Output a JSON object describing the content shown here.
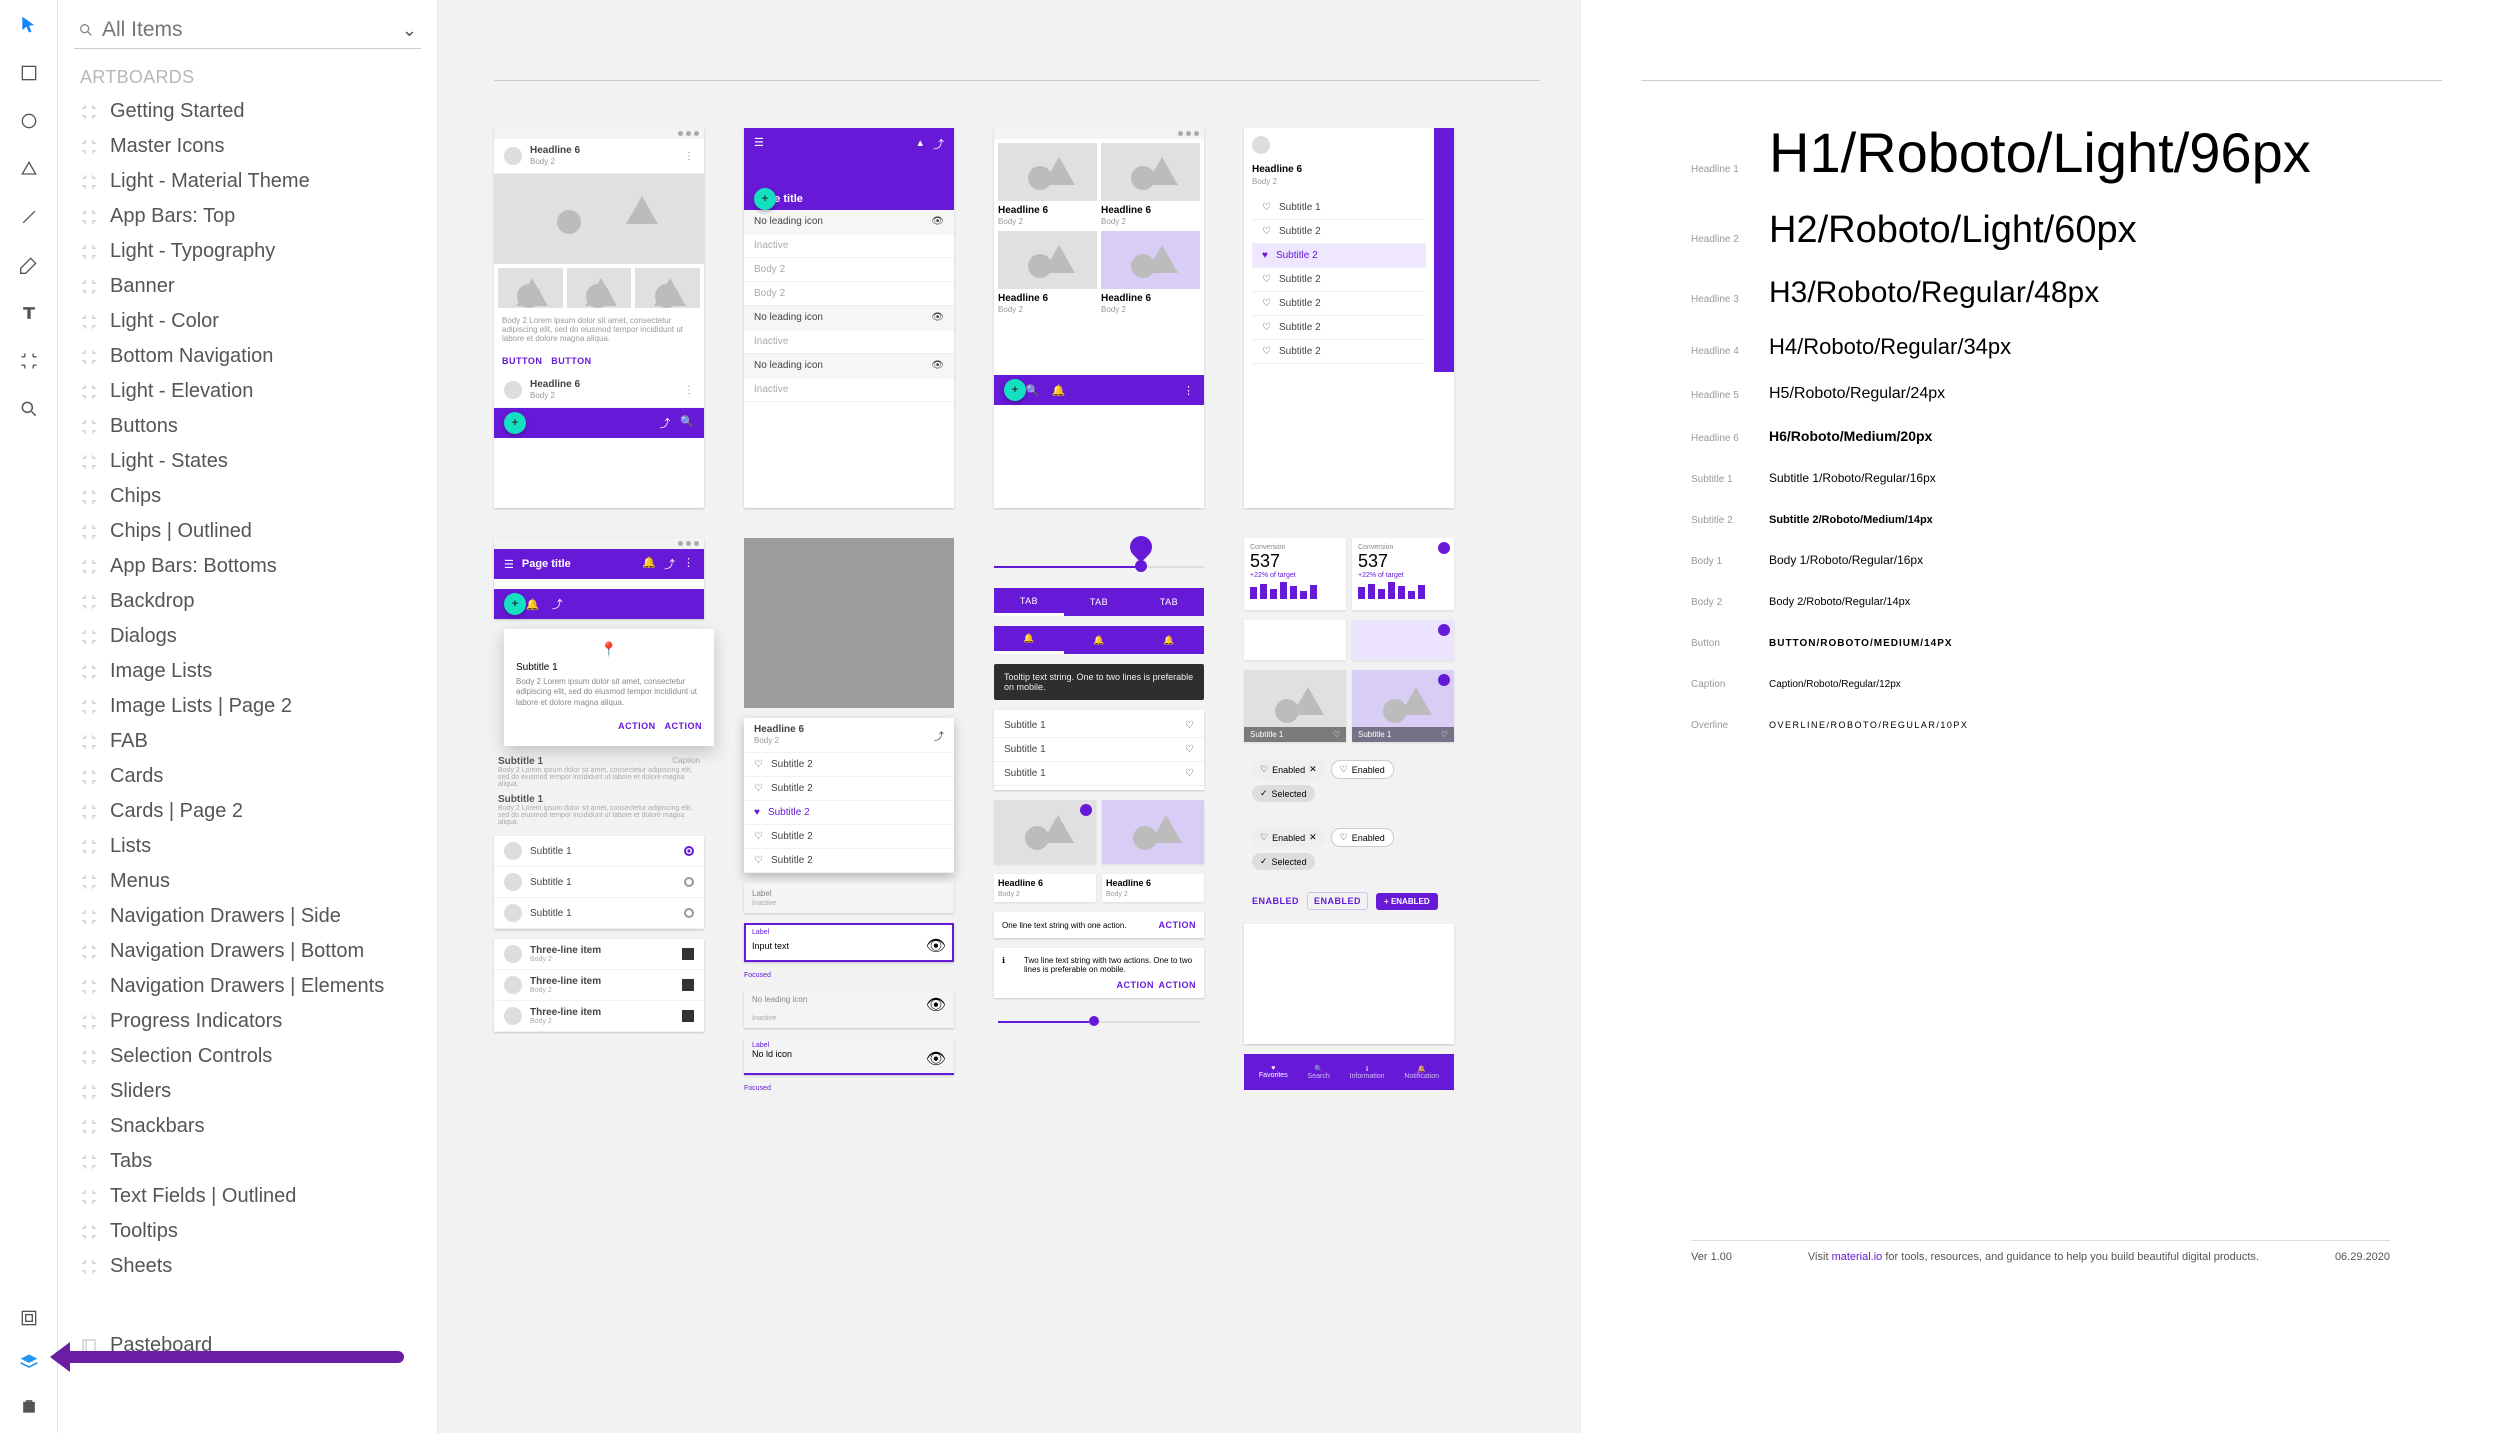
{
  "search": {
    "placeholder": "All Items"
  },
  "sections": {
    "artboards": "ARTBOARDS"
  },
  "artboards": [
    "Getting Started",
    "Master Icons",
    "Light - Material Theme",
    "App Bars: Top",
    "Light - Typography",
    "Banner",
    "Light - Color",
    "Bottom Navigation",
    "Light - Elevation",
    "Buttons",
    "Light - States",
    "Chips",
    "Chips | Outlined",
    "App Bars: Bottoms",
    "Backdrop",
    "Dialogs",
    "Image Lists",
    "Image Lists | Page 2",
    "FAB",
    "Cards",
    "Cards | Page 2",
    "Lists",
    "Menus",
    "Navigation Drawers | Side",
    "Navigation Drawers | Bottom",
    "Navigation Drawers | Elements",
    "Progress Indicators",
    "Selection Controls",
    "Sliders",
    "Snackbars",
    "Tabs",
    "Text Fields | Outlined",
    "Tooltips",
    "Sheets"
  ],
  "pasteboard": "Pasteboard",
  "canvas": {
    "headline6": "Headline 6",
    "body2": "Body 2",
    "pageTitle": "Page title",
    "noLeading": "No leading icon",
    "inactive": "Inactive",
    "subtitle1": "Subtitle 1",
    "subtitle2": "Subtitle 2",
    "threeLine": "Three-line item",
    "inputText": "Input text",
    "label": "Label",
    "focused": "Focused",
    "noIdIcon": "No ld icon",
    "action": "ACTION",
    "button": "BUTTON",
    "tab": "TAB",
    "snackOne": "One line text string with one action.",
    "snackTwo": "Two line text string with two actions. One to two lines is preferable on mobile.",
    "tooltip": "Tooltip text string. One to two lines is preferable on mobile.",
    "enabled": "Enabled",
    "enabledUpper": "ENABLED",
    "selected": "Selected",
    "caption": "Caption",
    "lorem": "Body 2 Lorem ipsum dolor sit amet, consectetur adipiscing elit, sed do eiusmod tempor incididunt ut labore et dolore magna aliqua.",
    "statNum": "537",
    "statLabel": "Conversion",
    "statPct": "+22% of target",
    "favorites": "Favorites",
    "search2": "Search",
    "information": "Information",
    "notification": "Notification"
  },
  "typography": {
    "rows": [
      {
        "label": "Headline 1",
        "text": "H1/Roboto/Light/96px",
        "size": 56,
        "weight": 300
      },
      {
        "label": "Headline 2",
        "text": "H2/Roboto/Light/60px",
        "size": 38,
        "weight": 300
      },
      {
        "label": "Headline 3",
        "text": "H3/Roboto/Regular/48px",
        "size": 30,
        "weight": 400
      },
      {
        "label": "Headline 4",
        "text": "H4/Roboto/Regular/34px",
        "size": 22,
        "weight": 400
      },
      {
        "label": "Headline 5",
        "text": "H5/Roboto/Regular/24px",
        "size": 16,
        "weight": 400
      },
      {
        "label": "Headline 6",
        "text": "H6/Roboto/Medium/20px",
        "size": 14,
        "weight": 600
      },
      {
        "label": "Subtitle 1",
        "text": "Subtitle 1/Roboto/Regular/16px",
        "size": 12,
        "weight": 400
      },
      {
        "label": "Subtitle 2",
        "text": "Subtitle 2/Roboto/Medium/14px",
        "size": 11,
        "weight": 600
      },
      {
        "label": "Body 1",
        "text": "Body 1/Roboto/Regular/16px",
        "size": 12,
        "weight": 400
      },
      {
        "label": "Body 2",
        "text": "Body 2/Roboto/Regular/14px",
        "size": 11,
        "weight": 400
      },
      {
        "label": "Button",
        "text": "BUTTON/ROBOTO/MEDIUM/14PX",
        "size": 10,
        "weight": 600,
        "ls": 1
      },
      {
        "label": "Caption",
        "text": "Caption/Roboto/Regular/12px",
        "size": 10,
        "weight": 400
      },
      {
        "label": "Overline",
        "text": "OVERLINE/ROBOTO/REGULAR/10PX",
        "size": 9,
        "weight": 400,
        "ls": 1.5
      }
    ],
    "footer": {
      "ver": "Ver 1.00",
      "text": "Visit ",
      "link": "material.io",
      "rest": " for tools, resources, and guidance to help you build beautiful digital products.",
      "date": "06.29.2020"
    }
  }
}
